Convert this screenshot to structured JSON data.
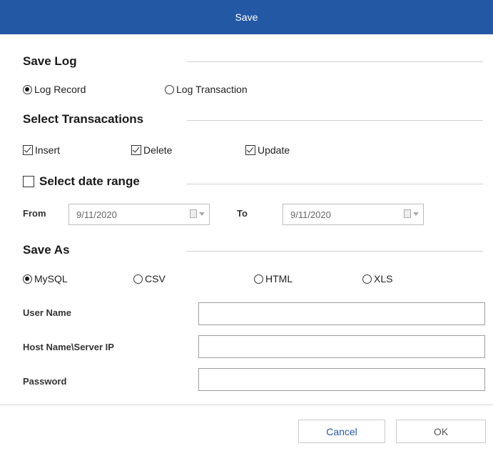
{
  "dialog": {
    "title": "Save"
  },
  "save_log": {
    "heading": "Save Log",
    "options": [
      {
        "label": "Log Record",
        "checked": true
      },
      {
        "label": "Log Transaction",
        "checked": false
      }
    ]
  },
  "transactions": {
    "heading": "Select Transacations",
    "options": [
      {
        "label": "Insert",
        "checked": true
      },
      {
        "label": "Delete",
        "checked": true
      },
      {
        "label": "Update",
        "checked": true
      }
    ]
  },
  "date_range": {
    "label": "Select date range",
    "checked": false,
    "from_label": "From",
    "from_value": "9/11/2020",
    "to_label": "To",
    "to_value": "9/11/2020"
  },
  "save_as": {
    "heading": "Save As",
    "options": [
      {
        "label": "MySQL",
        "checked": true
      },
      {
        "label": "CSV",
        "checked": false
      },
      {
        "label": "HTML",
        "checked": false
      },
      {
        "label": "XLS",
        "checked": false
      }
    ]
  },
  "form": {
    "user_name_label": "User Name",
    "user_name_value": "",
    "host_label": "Host Name\\Server IP",
    "host_value": "",
    "password_label": "Password",
    "password_value": ""
  },
  "footer": {
    "cancel_label": "Cancel",
    "ok_label": "OK"
  },
  "colors": {
    "titlebar": "#2358a5",
    "cancel_text": "#2358a5",
    "ok_text": "#555555"
  }
}
